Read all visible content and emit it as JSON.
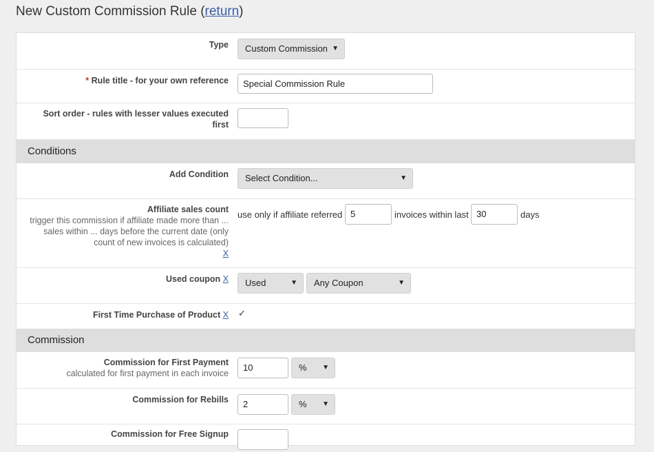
{
  "header": {
    "title": "New Custom Commission Rule",
    "open_paren": "(",
    "return_link": "return",
    "close_paren": ")"
  },
  "fields": {
    "type": {
      "label": "Type",
      "value": "Custom Commission"
    },
    "rule_title": {
      "required_mark": "*",
      "label": "Rule title - for your own reference",
      "value": "Special Commission Rule"
    },
    "sort_order": {
      "label": "Sort order - rules with lesser values executed first",
      "value": ""
    }
  },
  "conditions": {
    "heading": "Conditions",
    "add_condition": {
      "label": "Add Condition",
      "value": "Select Condition..."
    },
    "affiliate_sales_count": {
      "label": "Affiliate sales count",
      "description": "trigger this commission if affiliate made more than ... sales within ... days before the current date (only count of new invoices is calculated)",
      "remove": "X",
      "prefix": "use only if affiliate referred",
      "invoices_value": "5",
      "middle": "invoices within last",
      "days_value": "30",
      "suffix": "days"
    },
    "used_coupon": {
      "label": "Used coupon",
      "remove": "X",
      "status_value": "Used",
      "coupon_value": "Any Coupon"
    },
    "first_time_purchase": {
      "label": "First Time Purchase of Product",
      "remove": "X",
      "check": "✓"
    }
  },
  "commission": {
    "heading": "Commission",
    "first_payment": {
      "label": "Commission for First Payment",
      "description": "calculated for first payment in each invoice",
      "value": "10",
      "unit": "%"
    },
    "rebills": {
      "label": "Commission for Rebills",
      "value": "2",
      "unit": "%"
    },
    "free_signup": {
      "label": "Commission for Free Signup"
    }
  },
  "icons": {
    "caret": "▼"
  }
}
